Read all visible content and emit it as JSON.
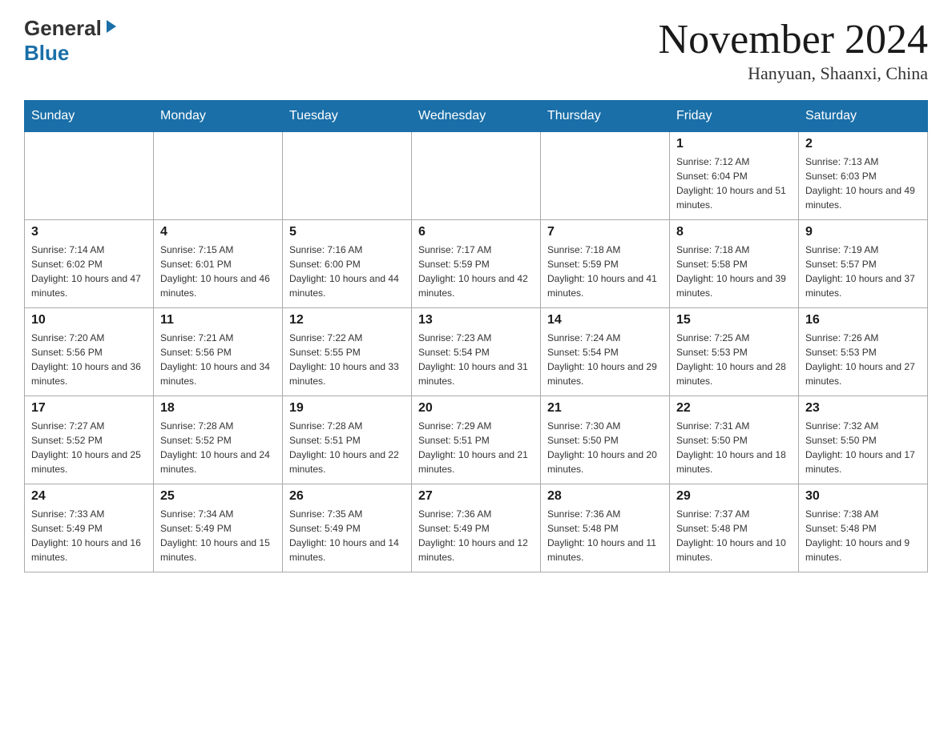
{
  "header": {
    "logo_general": "General",
    "logo_blue": "Blue",
    "month_title": "November 2024",
    "location": "Hanyuan, Shaanxi, China"
  },
  "weekdays": [
    "Sunday",
    "Monday",
    "Tuesday",
    "Wednesday",
    "Thursday",
    "Friday",
    "Saturday"
  ],
  "weeks": [
    {
      "days": [
        {
          "num": "",
          "info": ""
        },
        {
          "num": "",
          "info": ""
        },
        {
          "num": "",
          "info": ""
        },
        {
          "num": "",
          "info": ""
        },
        {
          "num": "",
          "info": ""
        },
        {
          "num": "1",
          "info": "Sunrise: 7:12 AM\nSunset: 6:04 PM\nDaylight: 10 hours and 51 minutes."
        },
        {
          "num": "2",
          "info": "Sunrise: 7:13 AM\nSunset: 6:03 PM\nDaylight: 10 hours and 49 minutes."
        }
      ]
    },
    {
      "days": [
        {
          "num": "3",
          "info": "Sunrise: 7:14 AM\nSunset: 6:02 PM\nDaylight: 10 hours and 47 minutes."
        },
        {
          "num": "4",
          "info": "Sunrise: 7:15 AM\nSunset: 6:01 PM\nDaylight: 10 hours and 46 minutes."
        },
        {
          "num": "5",
          "info": "Sunrise: 7:16 AM\nSunset: 6:00 PM\nDaylight: 10 hours and 44 minutes."
        },
        {
          "num": "6",
          "info": "Sunrise: 7:17 AM\nSunset: 5:59 PM\nDaylight: 10 hours and 42 minutes."
        },
        {
          "num": "7",
          "info": "Sunrise: 7:18 AM\nSunset: 5:59 PM\nDaylight: 10 hours and 41 minutes."
        },
        {
          "num": "8",
          "info": "Sunrise: 7:18 AM\nSunset: 5:58 PM\nDaylight: 10 hours and 39 minutes."
        },
        {
          "num": "9",
          "info": "Sunrise: 7:19 AM\nSunset: 5:57 PM\nDaylight: 10 hours and 37 minutes."
        }
      ]
    },
    {
      "days": [
        {
          "num": "10",
          "info": "Sunrise: 7:20 AM\nSunset: 5:56 PM\nDaylight: 10 hours and 36 minutes."
        },
        {
          "num": "11",
          "info": "Sunrise: 7:21 AM\nSunset: 5:56 PM\nDaylight: 10 hours and 34 minutes."
        },
        {
          "num": "12",
          "info": "Sunrise: 7:22 AM\nSunset: 5:55 PM\nDaylight: 10 hours and 33 minutes."
        },
        {
          "num": "13",
          "info": "Sunrise: 7:23 AM\nSunset: 5:54 PM\nDaylight: 10 hours and 31 minutes."
        },
        {
          "num": "14",
          "info": "Sunrise: 7:24 AM\nSunset: 5:54 PM\nDaylight: 10 hours and 29 minutes."
        },
        {
          "num": "15",
          "info": "Sunrise: 7:25 AM\nSunset: 5:53 PM\nDaylight: 10 hours and 28 minutes."
        },
        {
          "num": "16",
          "info": "Sunrise: 7:26 AM\nSunset: 5:53 PM\nDaylight: 10 hours and 27 minutes."
        }
      ]
    },
    {
      "days": [
        {
          "num": "17",
          "info": "Sunrise: 7:27 AM\nSunset: 5:52 PM\nDaylight: 10 hours and 25 minutes."
        },
        {
          "num": "18",
          "info": "Sunrise: 7:28 AM\nSunset: 5:52 PM\nDaylight: 10 hours and 24 minutes."
        },
        {
          "num": "19",
          "info": "Sunrise: 7:28 AM\nSunset: 5:51 PM\nDaylight: 10 hours and 22 minutes."
        },
        {
          "num": "20",
          "info": "Sunrise: 7:29 AM\nSunset: 5:51 PM\nDaylight: 10 hours and 21 minutes."
        },
        {
          "num": "21",
          "info": "Sunrise: 7:30 AM\nSunset: 5:50 PM\nDaylight: 10 hours and 20 minutes."
        },
        {
          "num": "22",
          "info": "Sunrise: 7:31 AM\nSunset: 5:50 PM\nDaylight: 10 hours and 18 minutes."
        },
        {
          "num": "23",
          "info": "Sunrise: 7:32 AM\nSunset: 5:50 PM\nDaylight: 10 hours and 17 minutes."
        }
      ]
    },
    {
      "days": [
        {
          "num": "24",
          "info": "Sunrise: 7:33 AM\nSunset: 5:49 PM\nDaylight: 10 hours and 16 minutes."
        },
        {
          "num": "25",
          "info": "Sunrise: 7:34 AM\nSunset: 5:49 PM\nDaylight: 10 hours and 15 minutes."
        },
        {
          "num": "26",
          "info": "Sunrise: 7:35 AM\nSunset: 5:49 PM\nDaylight: 10 hours and 14 minutes."
        },
        {
          "num": "27",
          "info": "Sunrise: 7:36 AM\nSunset: 5:49 PM\nDaylight: 10 hours and 12 minutes."
        },
        {
          "num": "28",
          "info": "Sunrise: 7:36 AM\nSunset: 5:48 PM\nDaylight: 10 hours and 11 minutes."
        },
        {
          "num": "29",
          "info": "Sunrise: 7:37 AM\nSunset: 5:48 PM\nDaylight: 10 hours and 10 minutes."
        },
        {
          "num": "30",
          "info": "Sunrise: 7:38 AM\nSunset: 5:48 PM\nDaylight: 10 hours and 9 minutes."
        }
      ]
    }
  ]
}
